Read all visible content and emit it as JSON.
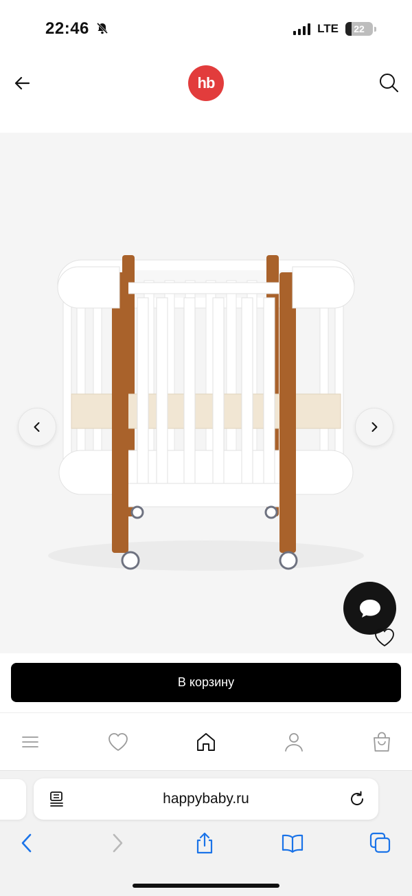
{
  "status_bar": {
    "time": "22:46",
    "network": "LTE",
    "battery": "22",
    "battery_level": 0.22
  },
  "header": {
    "logo_text": "hb",
    "brand_color": "#e23c3c"
  },
  "product": {
    "image_subject": "white round baby crib with wooden posts"
  },
  "actions": {
    "cart_label": "В корзину"
  },
  "site_nav": {
    "items": [
      "menu-icon",
      "heart-icon",
      "home-icon",
      "profile-icon",
      "bag-icon"
    ]
  },
  "browser": {
    "url": "happybaby.ru",
    "accent_color": "#1a73e8"
  }
}
